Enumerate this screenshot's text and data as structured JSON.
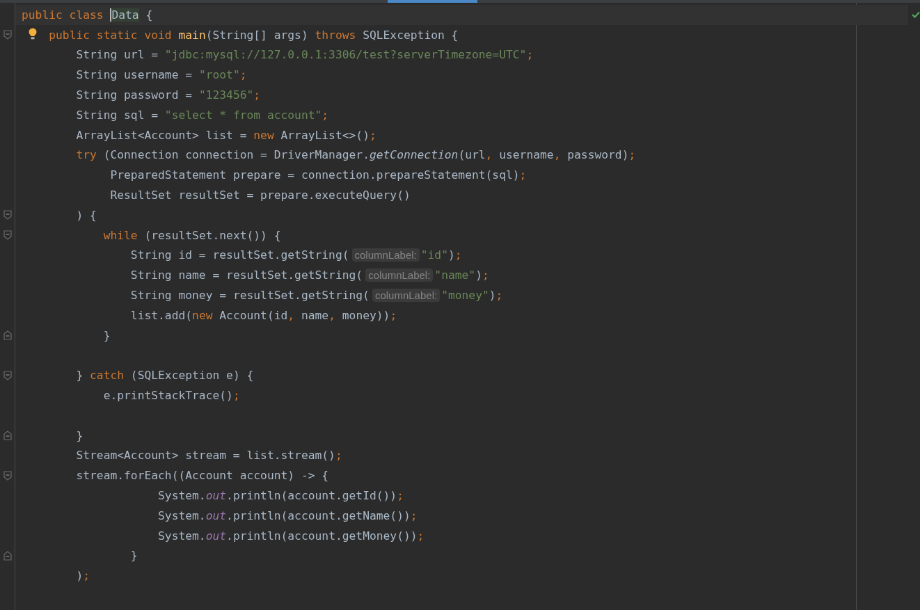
{
  "editor": {
    "inspection_passed": true,
    "lines": [
      {
        "kind": "code",
        "current": true,
        "bulb": false,
        "tokens": [
          {
            "kind": "keyword",
            "text": "public class "
          },
          {
            "kind": "match",
            "text": "Data",
            "caret": true
          },
          {
            "kind": "plain",
            "text": " {"
          }
        ]
      },
      {
        "kind": "fold-start",
        "current": false,
        "bulb": true,
        "tokens": [
          {
            "kind": "keyword",
            "text": "    public static void "
          },
          {
            "kind": "decl",
            "text": "main"
          },
          {
            "kind": "plain",
            "text": "(String[] args) "
          },
          {
            "kind": "keyword",
            "text": "throws"
          },
          {
            "kind": "plain",
            "text": " SQLException {"
          }
        ]
      },
      {
        "kind": "code",
        "current": false,
        "bulb": false,
        "tokens": [
          {
            "kind": "plain",
            "text": "        String url = "
          },
          {
            "kind": "string",
            "text": "\"jdbc:mysql://127.0.0.1:3306/test?serverTimezone=UTC\""
          },
          {
            "kind": "punct",
            "text": ";"
          }
        ]
      },
      {
        "kind": "code",
        "current": false,
        "bulb": false,
        "tokens": [
          {
            "kind": "plain",
            "text": "        String username = "
          },
          {
            "kind": "string",
            "text": "\"root\""
          },
          {
            "kind": "punct",
            "text": ";"
          }
        ]
      },
      {
        "kind": "code",
        "current": false,
        "bulb": false,
        "tokens": [
          {
            "kind": "plain",
            "text": "        String password = "
          },
          {
            "kind": "string",
            "text": "\"123456\""
          },
          {
            "kind": "punct",
            "text": ";"
          }
        ]
      },
      {
        "kind": "code",
        "current": false,
        "bulb": false,
        "tokens": [
          {
            "kind": "plain",
            "text": "        String sql = "
          },
          {
            "kind": "string",
            "text": "\"select * from account\""
          },
          {
            "kind": "punct",
            "text": ";"
          }
        ]
      },
      {
        "kind": "code",
        "current": false,
        "bulb": false,
        "tokens": [
          {
            "kind": "plain",
            "text": "        ArrayList<Account> list = "
          },
          {
            "kind": "keyword",
            "text": "new"
          },
          {
            "kind": "plain",
            "text": " ArrayList<>()"
          },
          {
            "kind": "punct",
            "text": ";"
          }
        ]
      },
      {
        "kind": "code",
        "current": false,
        "bulb": false,
        "tokens": [
          {
            "kind": "keyword",
            "text": "        try"
          },
          {
            "kind": "plain",
            "text": " (Connection connection = DriverManager."
          },
          {
            "kind": "static-call",
            "text": "getConnection"
          },
          {
            "kind": "plain",
            "text": "(url"
          },
          {
            "kind": "punct",
            "text": ","
          },
          {
            "kind": "plain",
            "text": " username"
          },
          {
            "kind": "punct",
            "text": ","
          },
          {
            "kind": "plain",
            "text": " password)"
          },
          {
            "kind": "punct",
            "text": ";"
          }
        ]
      },
      {
        "kind": "code",
        "current": false,
        "bulb": false,
        "tokens": [
          {
            "kind": "plain",
            "text": "             PreparedStatement prepare = connection.prepareStatement(sql)"
          },
          {
            "kind": "punct",
            "text": ";"
          }
        ]
      },
      {
        "kind": "code",
        "current": false,
        "bulb": false,
        "tokens": [
          {
            "kind": "plain",
            "text": "             ResultSet resultSet = prepare.executeQuery()"
          }
        ]
      },
      {
        "kind": "fold-start",
        "current": false,
        "bulb": false,
        "tokens": [
          {
            "kind": "plain",
            "text": "        ) {"
          }
        ]
      },
      {
        "kind": "fold-start",
        "current": false,
        "bulb": false,
        "tokens": [
          {
            "kind": "keyword",
            "text": "            while"
          },
          {
            "kind": "plain",
            "text": " (resultSet.next()) {"
          }
        ]
      },
      {
        "kind": "code",
        "current": false,
        "bulb": false,
        "tokens": [
          {
            "kind": "plain",
            "text": "                String id = resultSet.getString("
          },
          {
            "kind": "hint",
            "text": "columnLabel:"
          },
          {
            "kind": "string",
            "text": "\"id\""
          },
          {
            "kind": "plain",
            "text": ")"
          },
          {
            "kind": "punct",
            "text": ";"
          }
        ]
      },
      {
        "kind": "code",
        "current": false,
        "bulb": false,
        "tokens": [
          {
            "kind": "plain",
            "text": "                String name = resultSet.getString("
          },
          {
            "kind": "hint",
            "text": "columnLabel:"
          },
          {
            "kind": "string",
            "text": "\"name\""
          },
          {
            "kind": "plain",
            "text": ")"
          },
          {
            "kind": "punct",
            "text": ";"
          }
        ]
      },
      {
        "kind": "code",
        "current": false,
        "bulb": false,
        "tokens": [
          {
            "kind": "plain",
            "text": "                String money = resultSet.getString("
          },
          {
            "kind": "hint",
            "text": "columnLabel:"
          },
          {
            "kind": "string",
            "text": "\"money\""
          },
          {
            "kind": "plain",
            "text": ")"
          },
          {
            "kind": "punct",
            "text": ";"
          }
        ]
      },
      {
        "kind": "code",
        "current": false,
        "bulb": false,
        "tokens": [
          {
            "kind": "plain",
            "text": "                list.add("
          },
          {
            "kind": "keyword",
            "text": "new"
          },
          {
            "kind": "plain",
            "text": " Account(id"
          },
          {
            "kind": "punct",
            "text": ","
          },
          {
            "kind": "plain",
            "text": " name"
          },
          {
            "kind": "punct",
            "text": ","
          },
          {
            "kind": "plain",
            "text": " money))"
          },
          {
            "kind": "punct",
            "text": ";"
          }
        ]
      },
      {
        "kind": "fold-end",
        "current": false,
        "bulb": false,
        "tokens": [
          {
            "kind": "plain",
            "text": "            }"
          }
        ]
      },
      {
        "kind": "code",
        "current": false,
        "bulb": false
      },
      {
        "kind": "fold-start",
        "current": false,
        "bulb": false,
        "tokens": [
          {
            "kind": "plain",
            "text": "        } "
          },
          {
            "kind": "keyword",
            "text": "catch"
          },
          {
            "kind": "plain",
            "text": " (SQLException e) {"
          }
        ]
      },
      {
        "kind": "code",
        "current": false,
        "bulb": false,
        "tokens": [
          {
            "kind": "plain",
            "text": "            e.printStackTrace()"
          },
          {
            "kind": "punct",
            "text": ";"
          }
        ]
      },
      {
        "kind": "code",
        "current": false,
        "bulb": false
      },
      {
        "kind": "fold-end",
        "current": false,
        "bulb": false,
        "tokens": [
          {
            "kind": "plain",
            "text": "        }"
          }
        ]
      },
      {
        "kind": "code",
        "current": false,
        "bulb": false,
        "tokens": [
          {
            "kind": "plain",
            "text": "        Stream<Account> stream = list.stream()"
          },
          {
            "kind": "punct",
            "text": ";"
          }
        ]
      },
      {
        "kind": "fold-start",
        "current": false,
        "bulb": false,
        "tokens": [
          {
            "kind": "plain",
            "text": "        stream.forEach((Account account) -> {"
          }
        ]
      },
      {
        "kind": "code",
        "current": false,
        "bulb": false,
        "tokens": [
          {
            "kind": "plain",
            "text": "                    System."
          },
          {
            "kind": "field",
            "text": "out"
          },
          {
            "kind": "plain",
            "text": ".println(account.getId())"
          },
          {
            "kind": "punct",
            "text": ";"
          }
        ]
      },
      {
        "kind": "code",
        "current": false,
        "bulb": false,
        "tokens": [
          {
            "kind": "plain",
            "text": "                    System."
          },
          {
            "kind": "field",
            "text": "out"
          },
          {
            "kind": "plain",
            "text": ".println(account.getName())"
          },
          {
            "kind": "punct",
            "text": ";"
          }
        ]
      },
      {
        "kind": "code",
        "current": false,
        "bulb": false,
        "tokens": [
          {
            "kind": "plain",
            "text": "                    System."
          },
          {
            "kind": "field",
            "text": "out"
          },
          {
            "kind": "plain",
            "text": ".println(account.getMoney())"
          },
          {
            "kind": "punct",
            "text": ";"
          }
        ]
      },
      {
        "kind": "fold-end",
        "current": false,
        "bulb": false,
        "tokens": [
          {
            "kind": "plain",
            "text": "                }"
          }
        ]
      },
      {
        "kind": "code",
        "current": false,
        "bulb": false,
        "tokens": [
          {
            "kind": "plain",
            "text": "        )"
          },
          {
            "kind": "punct",
            "text": ";"
          }
        ]
      }
    ]
  }
}
